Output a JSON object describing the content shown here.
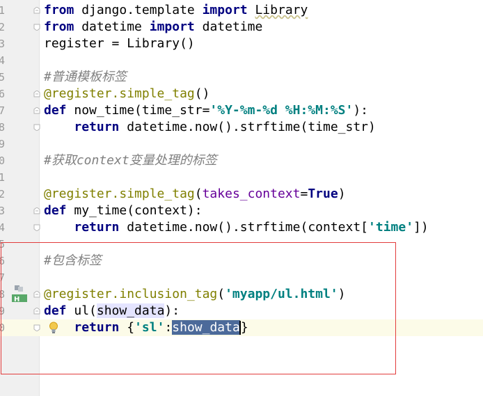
{
  "editor": {
    "line_numbers": [
      "1",
      "2",
      "3",
      "4",
      "5",
      "6",
      "7",
      "8",
      "9",
      "0",
      "1",
      "2",
      "3",
      "4",
      "5",
      "6",
      "7",
      "8",
      "9",
      "0"
    ],
    "lines": [
      {
        "tokens": [
          {
            "t": "from",
            "c": "kw"
          },
          {
            "t": " django.template ",
            "c": "ident"
          },
          {
            "t": "import",
            "c": "kw"
          },
          {
            "t": " ",
            "c": "ident"
          },
          {
            "t": "Library",
            "c": "squig"
          }
        ]
      },
      {
        "tokens": [
          {
            "t": "from",
            "c": "kw"
          },
          {
            "t": " datetime ",
            "c": "ident"
          },
          {
            "t": "import",
            "c": "kw"
          },
          {
            "t": " datetime",
            "c": "ident"
          }
        ]
      },
      {
        "tokens": [
          {
            "t": "register = Library()",
            "c": "ident"
          }
        ]
      },
      {
        "tokens": []
      },
      {
        "tokens": [
          {
            "t": "#普通模板标签",
            "c": "cmt"
          }
        ]
      },
      {
        "tokens": [
          {
            "t": "@register.simple_tag",
            "c": "dec"
          },
          {
            "t": "()",
            "c": "ident"
          }
        ]
      },
      {
        "tokens": [
          {
            "t": "def",
            "c": "kw"
          },
          {
            "t": " now_time(time_str=",
            "c": "ident"
          },
          {
            "t": "'%Y-%m-%d %H:%M:%S'",
            "c": "str"
          },
          {
            "t": "):",
            "c": "ident"
          }
        ]
      },
      {
        "tokens": [
          {
            "t": "    ",
            "c": "ident"
          },
          {
            "t": "return",
            "c": "kw"
          },
          {
            "t": " datetime.now().strftime(time_str)",
            "c": "ident"
          }
        ]
      },
      {
        "tokens": []
      },
      {
        "tokens": [
          {
            "t": "#获取context变量处理的标签",
            "c": "cmt"
          }
        ]
      },
      {
        "tokens": []
      },
      {
        "tokens": [
          {
            "t": "@register.simple_tag",
            "c": "dec"
          },
          {
            "t": "(",
            "c": "ident"
          },
          {
            "t": "takes_context",
            "c": "kwarg"
          },
          {
            "t": "=",
            "c": "ident"
          },
          {
            "t": "True",
            "c": "kw"
          },
          {
            "t": ")",
            "c": "ident"
          }
        ]
      },
      {
        "tokens": [
          {
            "t": "def",
            "c": "kw"
          },
          {
            "t": " my_time(context):",
            "c": "ident"
          }
        ]
      },
      {
        "tokens": [
          {
            "t": "    ",
            "c": "ident"
          },
          {
            "t": "return",
            "c": "kw"
          },
          {
            "t": " datetime.now().strftime(context[",
            "c": "ident"
          },
          {
            "t": "'time'",
            "c": "str"
          },
          {
            "t": "])",
            "c": "ident"
          }
        ]
      },
      {
        "tokens": []
      },
      {
        "tokens": [
          {
            "t": "#包含标签",
            "c": "cmt"
          }
        ]
      },
      {
        "tokens": []
      },
      {
        "tokens": [
          {
            "t": "@register.inclusion_tag",
            "c": "dec"
          },
          {
            "t": "(",
            "c": "ident"
          },
          {
            "t": "'myapp/ul.html'",
            "c": "str"
          },
          {
            "t": ")",
            "c": "ident"
          }
        ]
      },
      {
        "tokens": [
          {
            "t": "def",
            "c": "kw"
          },
          {
            "t": " ul(",
            "c": "ident"
          },
          {
            "t": "show_data",
            "c": "ref"
          },
          {
            "t": "):",
            "c": "ident"
          }
        ]
      },
      {
        "tokens": [
          {
            "t": "    ",
            "c": "ident"
          },
          {
            "t": "return",
            "c": "kw"
          },
          {
            "t": " {",
            "c": "ident"
          },
          {
            "t": "'sl'",
            "c": "str"
          },
          {
            "t": ":",
            "c": "ident"
          },
          {
            "t": "show_data",
            "c": "sel"
          },
          {
            "t": "}",
            "c": "ident"
          }
        ]
      }
    ],
    "current_line_index": 19,
    "gutter_badge_label": "H",
    "colors": {
      "keyword": "#000080",
      "string": "#008080",
      "comment": "#808080",
      "decorator": "#808000",
      "kwarg": "#660099",
      "selection": "#4c6a9a",
      "highlight_box": "#e23b3b",
      "current_line": "#fcfbe8"
    },
    "icons": [
      "fold-marker-icon",
      "intention-bulb-icon",
      "implemented-method-icon"
    ]
  }
}
